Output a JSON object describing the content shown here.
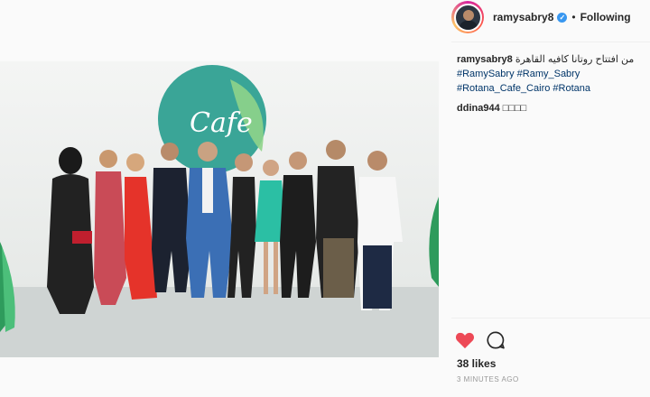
{
  "header": {
    "username": "ramysabry8",
    "verified_mark": "✓",
    "separator": "•",
    "follow_label": "Following"
  },
  "caption": {
    "username": "ramysabry8",
    "text": "من افتتاح روتانا كافيه القاهرة",
    "tags": [
      "#RamySabry",
      "#Ramy_Sabry",
      "#Rotana_Cafe_Cairo",
      "#Rotana"
    ]
  },
  "comment": {
    "username": "ddina944",
    "text": "□□□□"
  },
  "photo": {
    "logo_text": "Cafe",
    "icons": [
      "cafe-logo-icon"
    ]
  },
  "actions": {
    "like_icon": "heart-icon",
    "comment_icon": "comment-bubble-icon",
    "like_color": "#ed4956"
  },
  "likes_label": "38 likes",
  "timestamp": "3 MINUTES AGO"
}
